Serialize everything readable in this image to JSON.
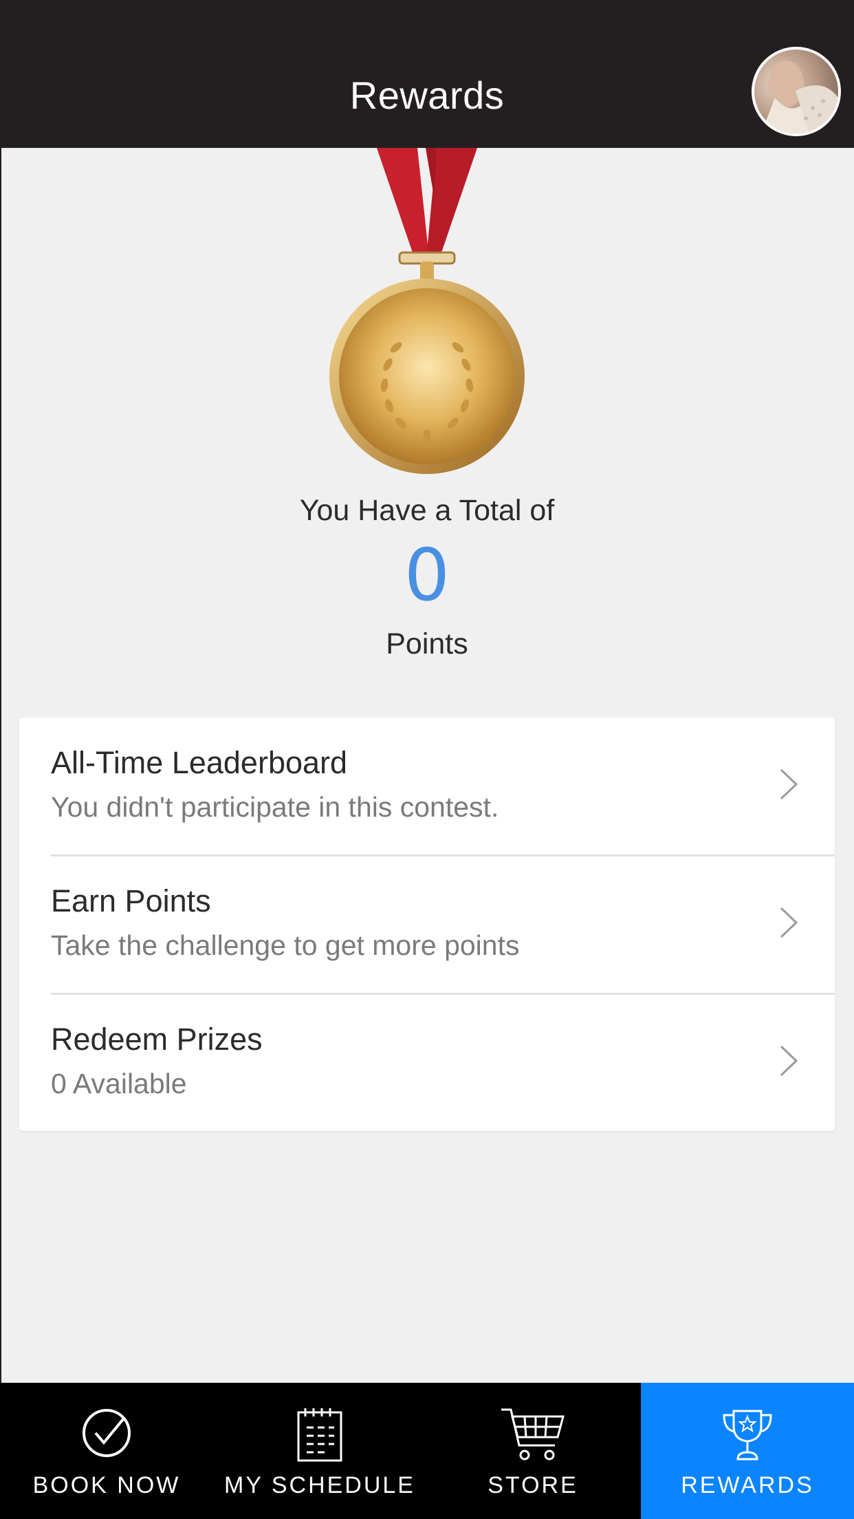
{
  "header": {
    "title": "Rewards"
  },
  "summary": {
    "caption": "You Have a Total of",
    "value": "0",
    "unit": "Points"
  },
  "menu": [
    {
      "title": "All-Time Leaderboard",
      "subtitle": "You didn't participate in this contest."
    },
    {
      "title": "Earn Points",
      "subtitle": "Take the challenge to get more points"
    },
    {
      "title": "Redeem Prizes",
      "subtitle": "0 Available"
    }
  ],
  "tabs": [
    {
      "label": "BOOK NOW",
      "icon": "check-circle-icon"
    },
    {
      "label": "MY SCHEDULE",
      "icon": "calendar-icon"
    },
    {
      "label": "STORE",
      "icon": "cart-icon"
    },
    {
      "label": "REWARDS",
      "icon": "trophy-icon",
      "active": true
    }
  ],
  "colors": {
    "header_bg": "#231f20",
    "points_accent": "#4a90e2",
    "tab_active": "#0a84ff",
    "tab_bar_bg": "#000000"
  }
}
